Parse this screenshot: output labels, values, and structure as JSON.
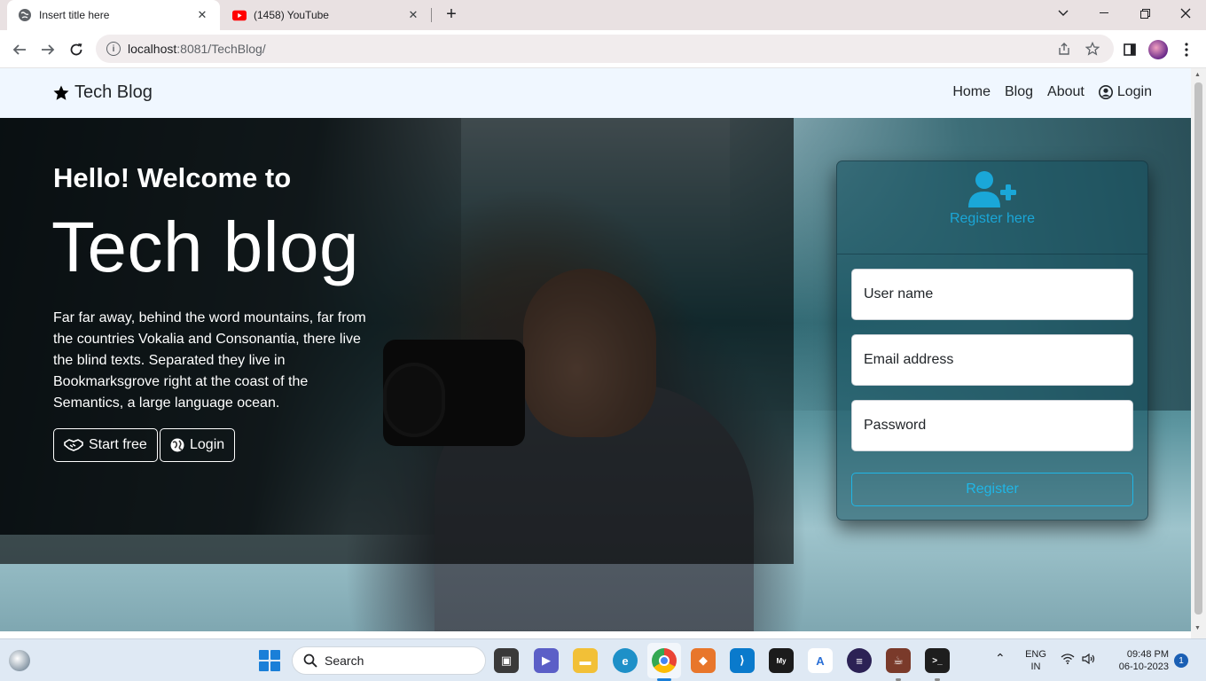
{
  "browser": {
    "tabs": [
      {
        "title": "Insert title here",
        "active": true
      },
      {
        "title": "(1458) YouTube",
        "active": false
      }
    ],
    "address": {
      "host": "localhost",
      "rest": ":8081/TechBlog/"
    }
  },
  "page": {
    "brand": "Tech Blog",
    "nav": {
      "home": "Home",
      "blog": "Blog",
      "about": "About",
      "login": "Login"
    },
    "hero": {
      "subtitle": "Hello! Welcome to",
      "title": "Tech blog",
      "paragraph": "Far far away, behind the word mountains, far from the countries Vokalia and Consonantia, there live the blind texts. Separated they live in Bookmarksgrove right at the coast of the Semantics, a large language ocean.",
      "start_button": "Start free",
      "login_button": "Login"
    },
    "register": {
      "title": "Register here",
      "username_placeholder": "User name",
      "email_placeholder": "Email address",
      "password_placeholder": "Password",
      "button": "Register"
    }
  },
  "taskbar": {
    "search": "Search",
    "lang_top": "ENG",
    "lang_bottom": "IN",
    "time": "09:48 PM",
    "date": "06-10-2023",
    "notifications": "1"
  },
  "colors": {
    "accent": "#20b6e6",
    "navbar_bg": "#f0f7ff",
    "chrome_bg": "#e9e1e2"
  }
}
